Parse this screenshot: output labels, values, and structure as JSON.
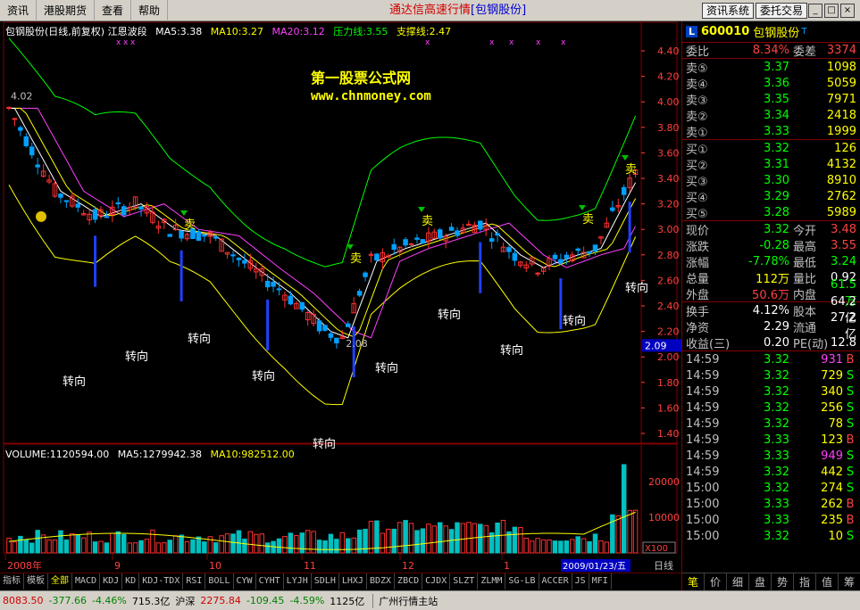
{
  "menu": [
    "资讯",
    "港股期货",
    "查看",
    "帮助"
  ],
  "title_left": "通达信高速行情",
  "title_stock": "[包钢股份]",
  "top_buttons": [
    "资讯系统",
    "委托交易"
  ],
  "window_buttons": [
    "_",
    "□",
    "×"
  ],
  "indicator": {
    "name": "包钢股份(日线,前复权) 江恩波段",
    "ma5": "MA5:3.38",
    "ma10": "MA10:3.27",
    "ma20": "MA20:3.12",
    "resist": "压力线:3.55",
    "support": "支撑线:2.47"
  },
  "watermark": {
    "line1": "第一股票公式网",
    "line2": "www.chnmoney.com"
  },
  "volume_line": {
    "vol": "VOLUME:1120594.00",
    "ma5": "MA5:1279942.38",
    "ma10": "MA10:982512.00"
  },
  "price_axis": [
    "4.40",
    "4.20",
    "4.00",
    "3.80",
    "3.60",
    "3.40",
    "3.20",
    "3.00",
    "2.80",
    "2.60",
    "2.40",
    "2.20",
    "2.00",
    "1.80",
    "1.60",
    "1.40"
  ],
  "price_marker": "2.09",
  "vol_axis": [
    "20000",
    "10000"
  ],
  "vol_unit": "X100",
  "date_axis": [
    "2008年",
    "9",
    "10",
    "11",
    "12",
    "1"
  ],
  "date_marker": "2009/01/23/五",
  "period": "日线",
  "chart_labels": {
    "high": "4.02",
    "low": "2.08",
    "turn": "转向",
    "sell": "卖"
  },
  "tabs": [
    "指标",
    "模板",
    "全部",
    "MACD",
    "KDJ",
    "KD",
    "KDJ-TDX",
    "RSI",
    "BOLL",
    "CYW",
    "CYHT",
    "LYJH",
    "SDLH",
    "LHXJ",
    "BDZX",
    "ZBCD",
    "CJDX",
    "SLZT",
    "ZLMM",
    "SG-LB",
    "ACCER",
    "JS",
    "MFI"
  ],
  "status": {
    "sh": "8083.50",
    "sh_chg": "-377.66",
    "sh_pct": "-4.46%",
    "sh_amt": "715.3亿",
    "hs_label": "沪深",
    "hs": "2275.84",
    "hs_chg": "-109.45",
    "hs_pct": "-4.59%",
    "hs_amt": "1125亿",
    "station": "广州行情主站"
  },
  "quote": {
    "badge": "L",
    "code": "600010",
    "name": "包钢股份",
    "tag": "T",
    "wb_label": "委比",
    "wb": "8.34%",
    "wc_label": "委差",
    "wc": "3374",
    "sells": [
      {
        "label": "卖⑤",
        "price": "3.37",
        "vol": "1098"
      },
      {
        "label": "卖④",
        "price": "3.36",
        "vol": "5059"
      },
      {
        "label": "卖③",
        "price": "3.35",
        "vol": "7971"
      },
      {
        "label": "卖②",
        "price": "3.34",
        "vol": "2418"
      },
      {
        "label": "卖①",
        "price": "3.33",
        "vol": "1999"
      }
    ],
    "buys": [
      {
        "label": "买①",
        "price": "3.32",
        "vol": "126"
      },
      {
        "label": "买②",
        "price": "3.31",
        "vol": "4132"
      },
      {
        "label": "买③",
        "price": "3.30",
        "vol": "8910"
      },
      {
        "label": "买④",
        "price": "3.29",
        "vol": "2762"
      },
      {
        "label": "买⑤",
        "price": "3.28",
        "vol": "5989"
      }
    ],
    "stats1": [
      {
        "l1": "现价",
        "v1": "3.32",
        "c1": "c-green",
        "l2": "今开",
        "v2": "3.48",
        "c2": "c-red"
      },
      {
        "l1": "涨跌",
        "v1": "-0.28",
        "c1": "c-green",
        "l2": "最高",
        "v2": "3.55",
        "c2": "c-red"
      },
      {
        "l1": "涨幅",
        "v1": "-7.78%",
        "c1": "c-green",
        "l2": "最低",
        "v2": "3.24",
        "c2": "c-green"
      },
      {
        "l1": "总量",
        "v1": "112万",
        "c1": "c-yel",
        "l2": "量比",
        "v2": "0.92",
        "c2": "c-white"
      },
      {
        "l1": "外盘",
        "v1": "50.6万",
        "c1": "c-red",
        "l2": "内盘",
        "v2": "61.5万",
        "c2": "c-green"
      }
    ],
    "stats2": [
      {
        "l1": "换手",
        "v1": "4.12%",
        "l2": "股本",
        "v2": "64.2亿"
      },
      {
        "l1": "净资",
        "v1": "2.29",
        "l2": "流通",
        "v2": "27.2亿"
      },
      {
        "l1": "收益(三)",
        "v1": "0.20",
        "l2": "PE(动)",
        "v2": "12.8"
      }
    ],
    "ticks": [
      {
        "t": "14:59",
        "p": "3.32",
        "v": "931",
        "d": "B",
        "vc": "c-mag"
      },
      {
        "t": "14:59",
        "p": "3.32",
        "v": "729",
        "d": "S",
        "vc": "c-yel"
      },
      {
        "t": "14:59",
        "p": "3.32",
        "v": "340",
        "d": "S",
        "vc": "c-yel"
      },
      {
        "t": "14:59",
        "p": "3.32",
        "v": "256",
        "d": "S",
        "vc": "c-yel"
      },
      {
        "t": "14:59",
        "p": "3.32",
        "v": "78",
        "d": "S",
        "vc": "c-yel"
      },
      {
        "t": "14:59",
        "p": "3.33",
        "v": "123",
        "d": "B",
        "vc": "c-yel"
      },
      {
        "t": "14:59",
        "p": "3.33",
        "v": "949",
        "d": "S",
        "vc": "c-mag"
      },
      {
        "t": "14:59",
        "p": "3.32",
        "v": "442",
        "d": "S",
        "vc": "c-yel"
      },
      {
        "t": "15:00",
        "p": "3.32",
        "v": "274",
        "d": "S",
        "vc": "c-yel"
      },
      {
        "t": "15:00",
        "p": "3.33",
        "v": "262",
        "d": "B",
        "vc": "c-yel"
      },
      {
        "t": "15:00",
        "p": "3.33",
        "v": "235",
        "d": "B",
        "vc": "c-yel"
      },
      {
        "t": "15:00",
        "p": "3.32",
        "v": "10",
        "d": "S",
        "vc": "c-yel"
      }
    ],
    "rtabs": [
      "笔",
      "价",
      "细",
      "盘",
      "势",
      "指",
      "值",
      "筹"
    ]
  },
  "colors": {
    "up": "#ff3030",
    "down": "#00a0ff",
    "ma5": "#ffffff",
    "ma10": "#ffff00",
    "ma20": "#ff40ff",
    "resist": "#00ff00",
    "support": "#ffff00"
  }
}
